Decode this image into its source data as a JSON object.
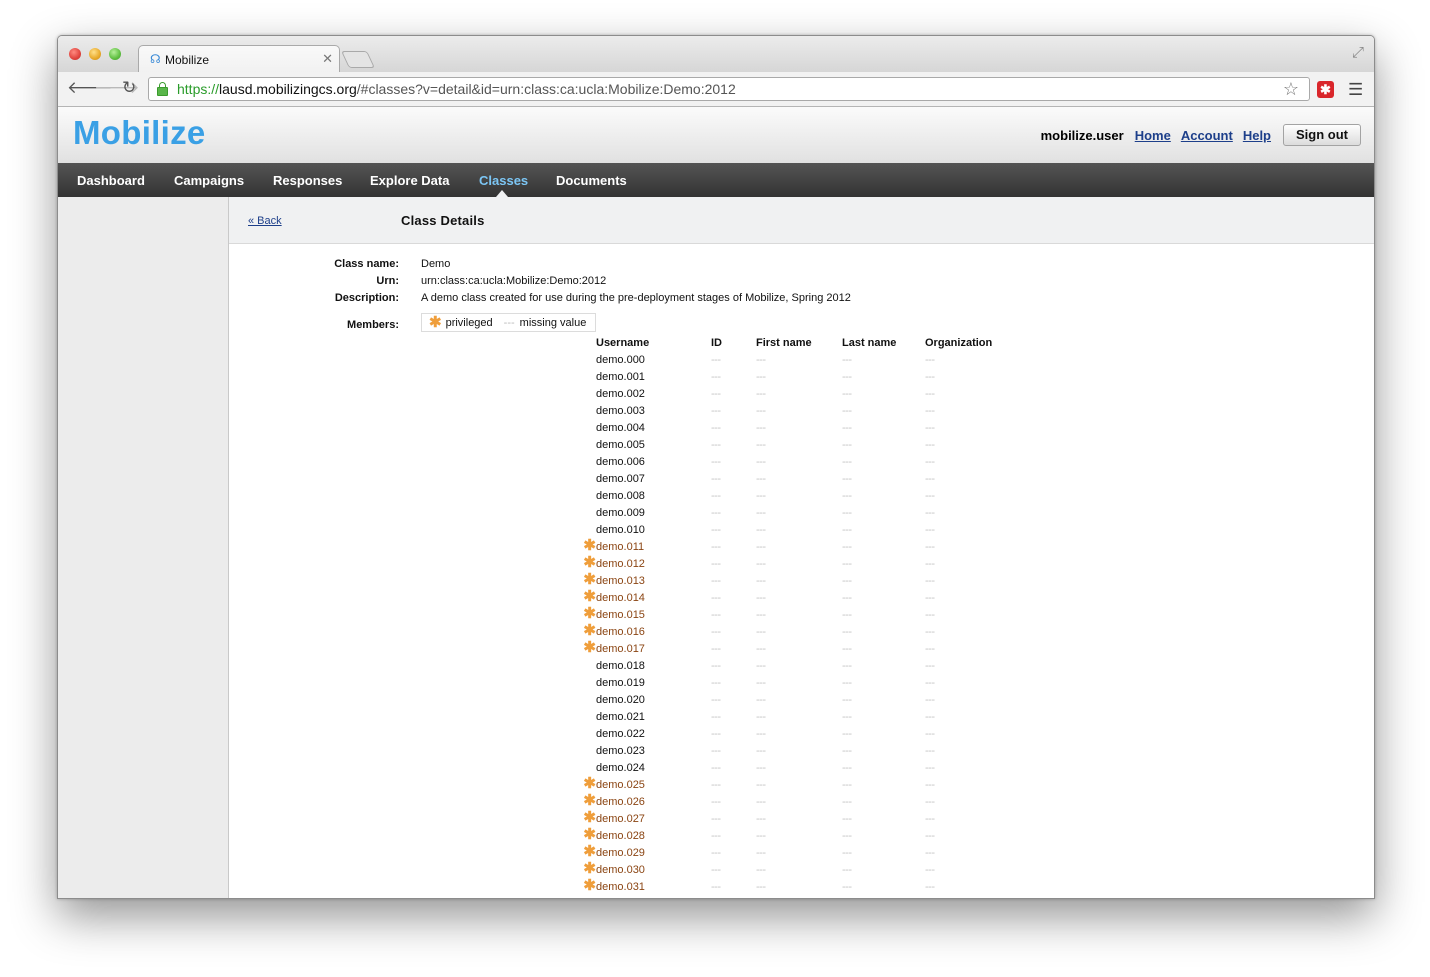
{
  "browser": {
    "tab_title": "Mobilize",
    "url_scheme": "https://",
    "url_host": "lausd.mobilizingcs.org",
    "url_path": "/#classes?v=detail&id=urn:class:ca:ucla:Mobilize:Demo:2012"
  },
  "header": {
    "logo": "Mobilize",
    "username": "mobilize.user",
    "links": [
      "Home",
      "Account",
      "Help"
    ],
    "signout_label": "Sign out"
  },
  "nav": {
    "items": [
      "Dashboard",
      "Campaigns",
      "Responses",
      "Explore Data",
      "Classes",
      "Documents"
    ],
    "active": "Classes"
  },
  "details": {
    "back_label": "« Back",
    "title": "Class Details",
    "class_name_label": "Class name:",
    "class_name": "Demo",
    "urn_label": "Urn:",
    "urn": "urn:class:ca:ucla:Mobilize:Demo:2012",
    "description_label": "Description:",
    "description": "A demo class created for use during the pre-deployment stages of Mobilize, Spring 2012",
    "members_label": "Members:",
    "legend_privileged": "privileged",
    "legend_missing_symbol": "---",
    "legend_missing": "missing value"
  },
  "members": {
    "columns": [
      "Username",
      "ID",
      "First name",
      "Last name",
      "Organization"
    ],
    "missing": "---",
    "rows": [
      {
        "username": "demo.000",
        "privileged": false
      },
      {
        "username": "demo.001",
        "privileged": false
      },
      {
        "username": "demo.002",
        "privileged": false
      },
      {
        "username": "demo.003",
        "privileged": false
      },
      {
        "username": "demo.004",
        "privileged": false
      },
      {
        "username": "demo.005",
        "privileged": false
      },
      {
        "username": "demo.006",
        "privileged": false
      },
      {
        "username": "demo.007",
        "privileged": false
      },
      {
        "username": "demo.008",
        "privileged": false
      },
      {
        "username": "demo.009",
        "privileged": false
      },
      {
        "username": "demo.010",
        "privileged": false
      },
      {
        "username": "demo.011",
        "privileged": true
      },
      {
        "username": "demo.012",
        "privileged": true
      },
      {
        "username": "demo.013",
        "privileged": true
      },
      {
        "username": "demo.014",
        "privileged": true
      },
      {
        "username": "demo.015",
        "privileged": true
      },
      {
        "username": "demo.016",
        "privileged": true
      },
      {
        "username": "demo.017",
        "privileged": true
      },
      {
        "username": "demo.018",
        "privileged": false
      },
      {
        "username": "demo.019",
        "privileged": false
      },
      {
        "username": "demo.020",
        "privileged": false
      },
      {
        "username": "demo.021",
        "privileged": false
      },
      {
        "username": "demo.022",
        "privileged": false
      },
      {
        "username": "demo.023",
        "privileged": false
      },
      {
        "username": "demo.024",
        "privileged": false
      },
      {
        "username": "demo.025",
        "privileged": true
      },
      {
        "username": "demo.026",
        "privileged": true
      },
      {
        "username": "demo.027",
        "privileged": true
      },
      {
        "username": "demo.028",
        "privileged": true
      },
      {
        "username": "demo.029",
        "privileged": true
      },
      {
        "username": "demo.030",
        "privileged": true
      },
      {
        "username": "demo.031",
        "privileged": true
      }
    ]
  },
  "colors": {
    "logo": "#3aa0e5",
    "nav_active": "#7cc6f5",
    "privileged_text": "#8b4513",
    "privileged_icon": "#ef9e3b",
    "link": "#1d3f8a"
  }
}
